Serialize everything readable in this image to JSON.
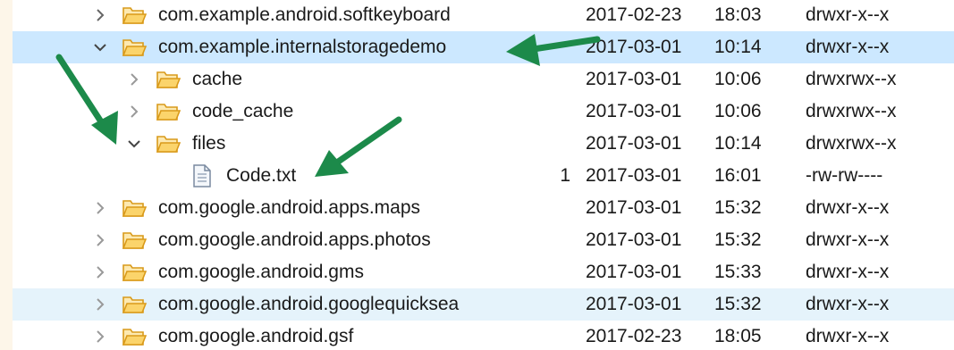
{
  "accent_colors": {
    "selected_row": "#cce8ff",
    "hover_row": "#e5f3fb",
    "annotation_arrow": "#1c8a4a",
    "folder": "#e8a317"
  },
  "rows": [
    {
      "name": "com.example.android.softkeyboard",
      "size": "",
      "date": "2017-02-23",
      "time": "18:03",
      "permissions": "drwxr-x--x",
      "type": "folder",
      "expander": "collapsed"
    },
    {
      "name": "com.example.internalstoragedemo",
      "size": "",
      "date": "2017-03-01",
      "time": "10:14",
      "permissions": "drwxr-x--x",
      "type": "folder",
      "expander": "expanded"
    },
    {
      "name": "cache",
      "size": "",
      "date": "2017-03-01",
      "time": "10:06",
      "permissions": "drwxrwx--x",
      "type": "folder",
      "expander": "collapsed"
    },
    {
      "name": "code_cache",
      "size": "",
      "date": "2017-03-01",
      "time": "10:06",
      "permissions": "drwxrwx--x",
      "type": "folder",
      "expander": "collapsed"
    },
    {
      "name": "files",
      "size": "",
      "date": "2017-03-01",
      "time": "10:14",
      "permissions": "drwxrwx--x",
      "type": "folder",
      "expander": "expanded"
    },
    {
      "name": "Code.txt",
      "size": "1",
      "date": "2017-03-01",
      "time": "16:01",
      "permissions": "-rw-rw----",
      "type": "file",
      "expander": "none"
    },
    {
      "name": "com.google.android.apps.maps",
      "size": "",
      "date": "2017-03-01",
      "time": "15:32",
      "permissions": "drwxr-x--x",
      "type": "folder",
      "expander": "collapsed"
    },
    {
      "name": "com.google.android.apps.photos",
      "size": "",
      "date": "2017-03-01",
      "time": "15:32",
      "permissions": "drwxr-x--x",
      "type": "folder",
      "expander": "collapsed"
    },
    {
      "name": "com.google.android.gms",
      "size": "",
      "date": "2017-03-01",
      "time": "15:33",
      "permissions": "drwxr-x--x",
      "type": "folder",
      "expander": "collapsed"
    },
    {
      "name": "com.google.android.googlequicksea",
      "size": "",
      "date": "2017-03-01",
      "time": "15:32",
      "permissions": "drwxr-x--x",
      "type": "folder",
      "expander": "collapsed"
    },
    {
      "name": "com.google.android.gsf",
      "size": "",
      "date": "2017-02-23",
      "time": "18:05",
      "permissions": "drwxr-x--x",
      "type": "folder",
      "expander": "collapsed"
    }
  ]
}
